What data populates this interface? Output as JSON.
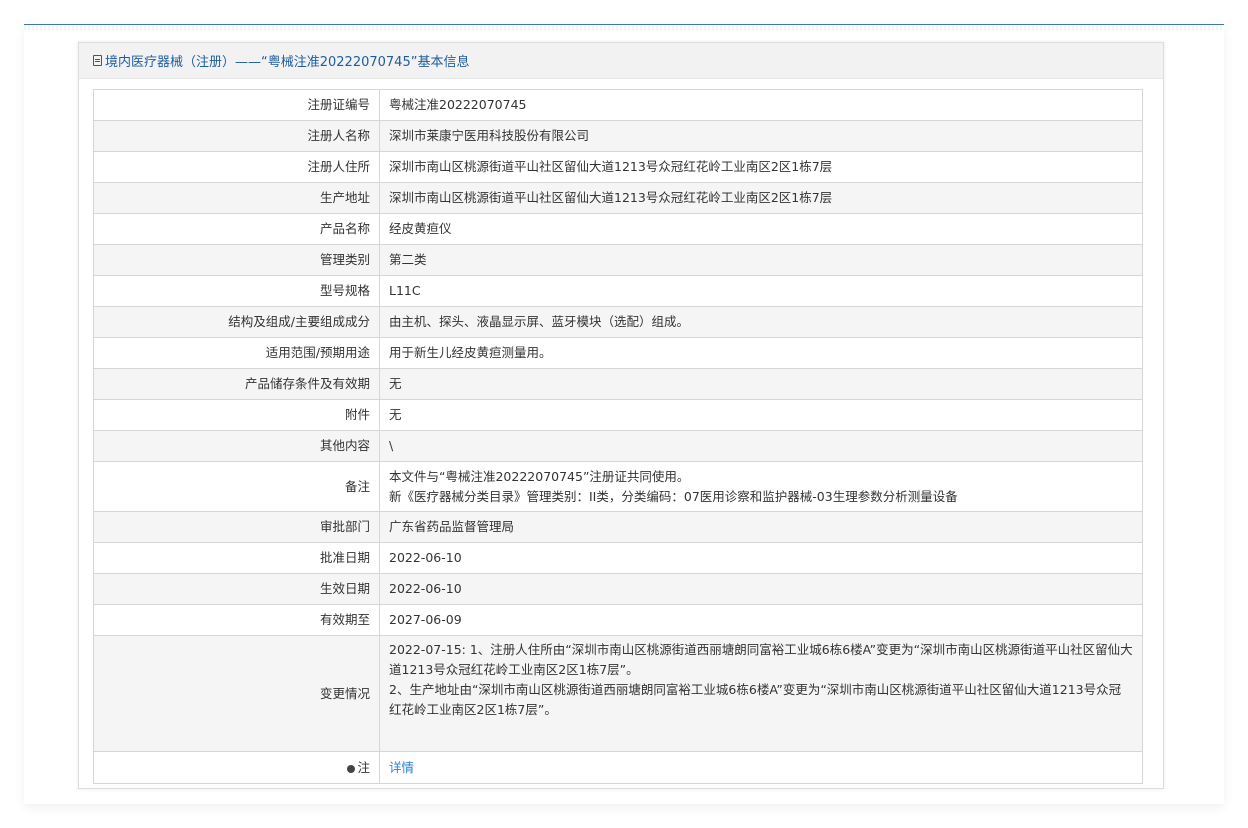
{
  "header": {
    "title": "境内医疗器械（注册）——“粤械注准20222070745”基本信息"
  },
  "rows": [
    {
      "label": "注册证编号",
      "value": "粤械注准20222070745"
    },
    {
      "label": "注册人名称",
      "value": "深圳市莱康宁医用科技股份有限公司"
    },
    {
      "label": "注册人住所",
      "value": "深圳市南山区桃源街道平山社区留仙大道1213号众冠红花岭工业南区2区1栋7层"
    },
    {
      "label": "生产地址",
      "value": "深圳市南山区桃源街道平山社区留仙大道1213号众冠红花岭工业南区2区1栋7层"
    },
    {
      "label": "产品名称",
      "value": "经皮黄疸仪"
    },
    {
      "label": "管理类别",
      "value": "第二类"
    },
    {
      "label": "型号规格",
      "value": "L11C"
    },
    {
      "label": "结构及组成/主要组成成分",
      "value": "由主机、探头、液晶显示屏、蓝牙模块（选配）组成。"
    },
    {
      "label": "适用范围/预期用途",
      "value": "用于新生儿经皮黄疸测量用。"
    },
    {
      "label": "产品储存条件及有效期",
      "value": "无"
    },
    {
      "label": "附件",
      "value": "无"
    },
    {
      "label": "其他内容",
      "value": "\\"
    },
    {
      "label": "备注",
      "line1": "本文件与“粤械注准20222070745”注册证共同使用。",
      "line2": "新《医疗器械分类目录》管理类别：II类，分类编码：07医用诊察和监护器械-03生理参数分析测量设备"
    },
    {
      "label": "审批部门",
      "value": "广东省药品监督管理局"
    },
    {
      "label": "批准日期",
      "value": "2022-06-10"
    },
    {
      "label": "生效日期",
      "value": "2022-06-10"
    },
    {
      "label": "有效期至",
      "value": "2027-06-09"
    },
    {
      "label": "变更情况",
      "line1": "2022-07-15: 1、注册人住所由“深圳市南山区桃源街道西丽塘朗同富裕工业城6栋6楼A”变更为“深圳市南山区桃源街道平山社区留仙大道1213号众冠红花岭工业南区2区1栋7层”。",
      "line2": "2、生产地址由“深圳市南山区桃源街道西丽塘朗同富裕工业城6栋6楼A”变更为“深圳市南山区桃源街道平山社区留仙大道1213号众冠红花岭工业南区2区1栋7层”。"
    },
    {
      "label": "注",
      "link": "详情"
    }
  ],
  "icons": {
    "header_icon": "document-icon",
    "note_icon": "map-pin-icon"
  },
  "colors": {
    "accent": "#1f5d9e",
    "link": "#2a7fd4"
  }
}
